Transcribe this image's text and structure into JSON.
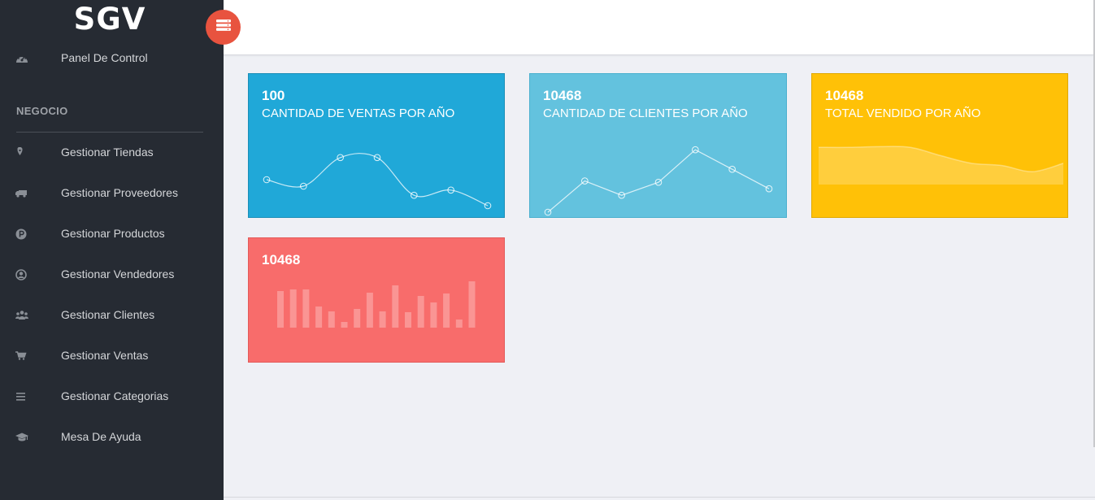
{
  "brand": {
    "title": "SGV"
  },
  "sidebar": {
    "dashboard": {
      "label": "Panel De Control",
      "icon": "speedometer-icon"
    },
    "section_title": "NEGOCIO",
    "items": [
      {
        "label": "Gestionar Tiendas",
        "icon": "location-pin-icon"
      },
      {
        "label": "Gestionar Proveedores",
        "icon": "truck-icon"
      },
      {
        "label": "Gestionar Productos",
        "icon": "parking-circle-icon"
      },
      {
        "label": "Gestionar Vendedores",
        "icon": "user-circle-icon"
      },
      {
        "label": "Gestionar Clientes",
        "icon": "users-icon"
      },
      {
        "label": "Gestionar Ventas",
        "icon": "cart-icon"
      },
      {
        "label": "Gestionar Categorias",
        "icon": "list-icon"
      },
      {
        "label": "Mesa De Ayuda",
        "icon": "graduation-cap-icon"
      }
    ]
  },
  "toggle": {
    "icon": "menu-toggle-icon",
    "color": "#e8533f"
  },
  "cards": [
    {
      "value": "100",
      "caption": "CANTIDAD DE VENTAS POR AÑO",
      "color": "#20a8d8"
    },
    {
      "value": "10468",
      "caption": "CANTIDAD DE CLIENTES POR AÑO",
      "color": "#63c2de"
    },
    {
      "value": "10468",
      "caption": "TOTAL VENDIDO POR AÑO",
      "color": "#ffc107"
    },
    {
      "value": "10468",
      "caption": "",
      "color": "#f86c6b"
    }
  ],
  "chart_data": [
    {
      "type": "line",
      "values": [
        55,
        50,
        72,
        72,
        43,
        47,
        35
      ]
    },
    {
      "type": "line",
      "values": [
        30,
        54,
        43,
        53,
        78,
        63,
        48
      ]
    },
    {
      "type": "area",
      "values": [
        79,
        79,
        80,
        79,
        68,
        58,
        55,
        47,
        58
      ]
    },
    {
      "type": "bar",
      "values": [
        45,
        47,
        47,
        26,
        20,
        7,
        23,
        43,
        20,
        52,
        19,
        39,
        31,
        42,
        10,
        57
      ]
    }
  ]
}
